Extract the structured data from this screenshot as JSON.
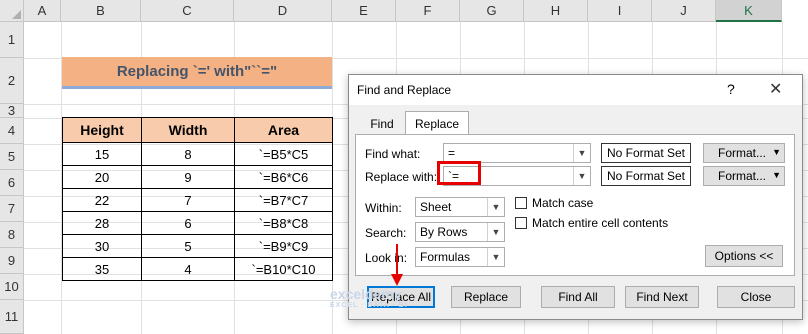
{
  "sheet": {
    "columns": [
      "A",
      "B",
      "C",
      "D",
      "E",
      "F",
      "G",
      "H",
      "I",
      "J",
      "K"
    ],
    "rows": [
      "1",
      "2",
      "3",
      "4",
      "5",
      "6",
      "7",
      "8",
      "9",
      "10",
      "11"
    ],
    "active_column": "K",
    "title": "Replacing `=' with\"``=\"",
    "table": {
      "headers": [
        "Height",
        "Width",
        "Area"
      ],
      "rows": [
        [
          "15",
          "8",
          "`=B5*C5"
        ],
        [
          "20",
          "9",
          "`=B6*C6"
        ],
        [
          "22",
          "7",
          "`=B7*C7"
        ],
        [
          "28",
          "6",
          "`=B8*C8"
        ],
        [
          "30",
          "5",
          "`=B9*C9"
        ],
        [
          "35",
          "4",
          "`=B10*C10"
        ]
      ]
    }
  },
  "dialog": {
    "title": "Find and Replace",
    "help": "?",
    "close": "✕",
    "tabs": [
      "Find",
      "Replace"
    ],
    "active_tab": "Replace",
    "find_what_label": "Find what:",
    "find_what_value": "=",
    "replace_with_label": "Replace with:",
    "replace_with_value": "`=",
    "no_format_set": "No Format Set",
    "format_button": "Format...",
    "within_label": "Within:",
    "within_value": "Sheet",
    "search_label": "Search:",
    "search_value": "By Rows",
    "look_in_label": "Look in:",
    "look_in_value": "Formulas",
    "match_case": "Match case",
    "match_entire": "Match entire cell contents",
    "options_button": "Options <<",
    "buttons": {
      "replace_all": "Replace All",
      "replace": "Replace",
      "find_all": "Find All",
      "find_next": "Find Next",
      "close": "Close"
    }
  },
  "watermark": {
    "name": "exceldemy",
    "tagline": "EXCEL · DATA · BI"
  },
  "colors": {
    "title_fill": "#f4b183",
    "header_fill": "#f8cbad",
    "highlight": "#e60000",
    "excel_green": "#217346",
    "default_button": "#0078d7"
  }
}
